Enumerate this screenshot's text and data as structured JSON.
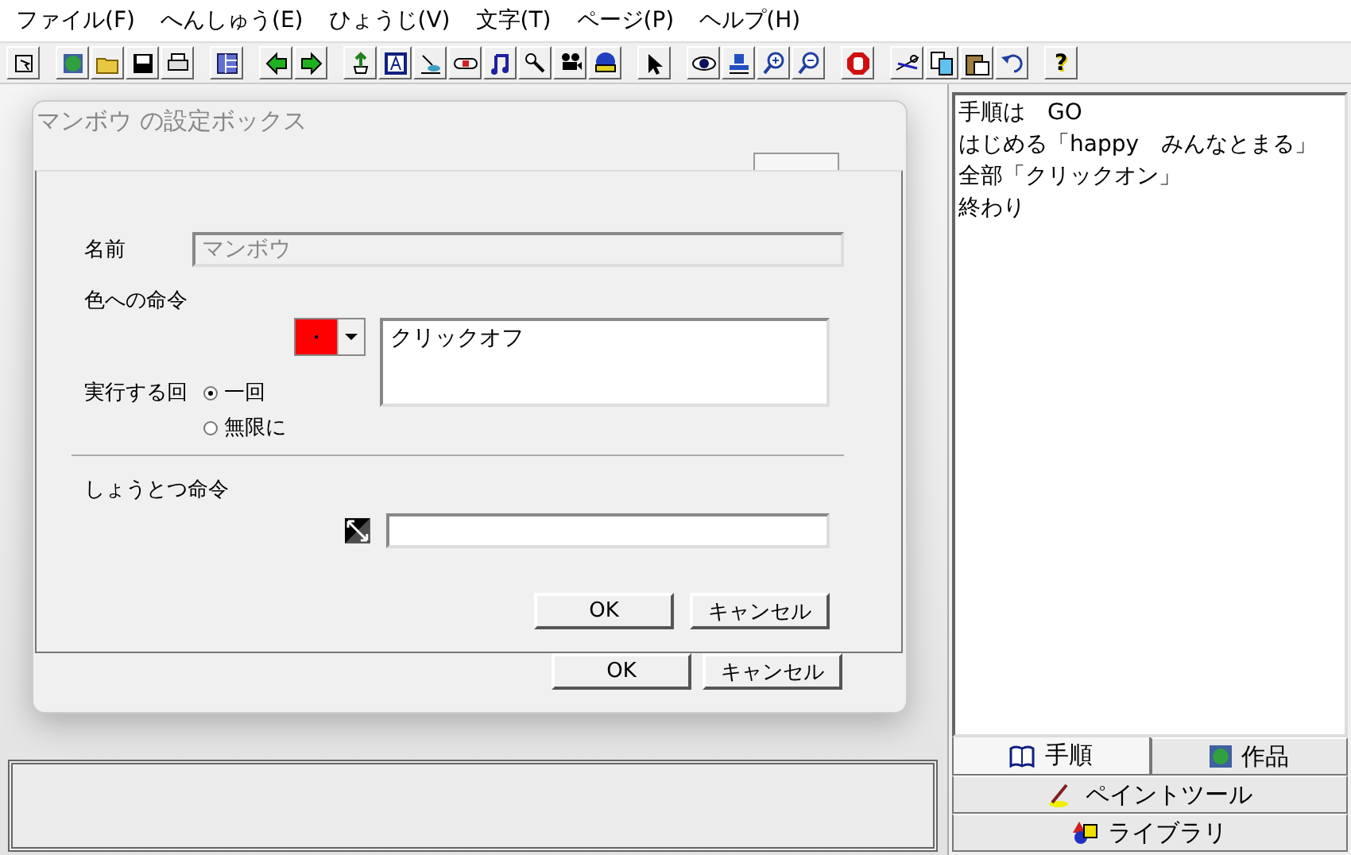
{
  "menu": [
    {
      "label": "ファイル(F)"
    },
    {
      "label": "へんしゅう(E)"
    },
    {
      "label": "ひょうじ(V)"
    },
    {
      "label": "文字(T)"
    },
    {
      "label": "ページ(P)"
    },
    {
      "label": "ヘルプ(H)"
    }
  ],
  "toolbar": {
    "help_label": "?"
  },
  "dialog": {
    "title": "マンボウ の設定ボックス",
    "name_label": "名前",
    "name_field": {
      "value": "マンボウ",
      "disabled": true
    },
    "color_command_label": "色への命令",
    "color_picker": {
      "color": "#ff0000"
    },
    "command_text": "クリックオフ",
    "repeat_label": "実行する回",
    "repeat_options": [
      {
        "label": "一回",
        "selected": true
      },
      {
        "label": "無限に",
        "selected": false
      }
    ],
    "collision_label": "しょうとつ命令",
    "buttons": [
      "OK",
      "キャンセル"
    ]
  },
  "background_buttons": [
    "OK",
    "キャンセル"
  ],
  "script_lines": [
    "手順は　GO",
    "はじめる「happy　みんなとまる」",
    "全部「クリックオン」",
    "終わり"
  ],
  "panel_tabs": [
    {
      "label": "手順",
      "selected": true
    },
    {
      "label": "作品",
      "selected": false
    },
    {
      "label": "ペイントツール",
      "selected": false
    },
    {
      "label": "ライブラリ",
      "selected": false
    }
  ]
}
